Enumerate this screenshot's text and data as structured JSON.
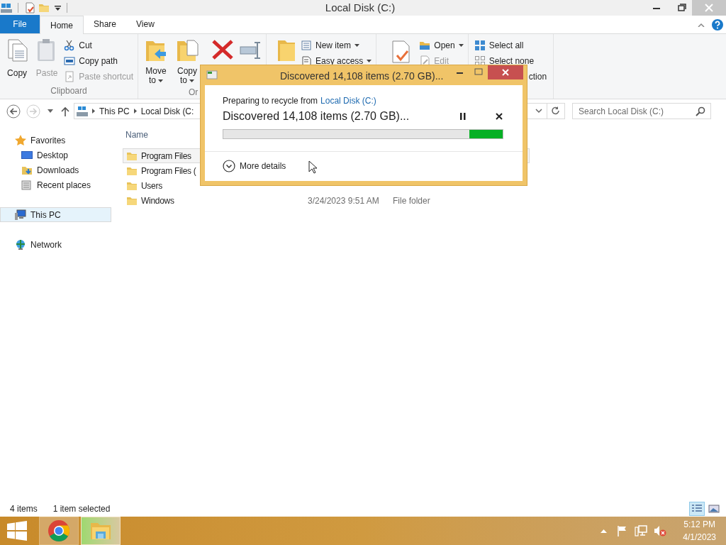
{
  "window": {
    "title": "Local Disk (C:)"
  },
  "ribbon_tabs": [
    {
      "label": "File",
      "kind": "file",
      "selected": false
    },
    {
      "label": "Home",
      "kind": "tab",
      "selected": true
    },
    {
      "label": "Share",
      "kind": "tab",
      "selected": false
    },
    {
      "label": "View",
      "kind": "tab",
      "selected": false
    }
  ],
  "ribbon": {
    "clipboard": {
      "large": [
        {
          "label": "Copy",
          "kind": "copy",
          "disabled": false
        },
        {
          "label": "Paste",
          "kind": "paste",
          "disabled": true
        }
      ],
      "small": [
        {
          "label": "Cut",
          "kind": "cut",
          "disabled": false
        },
        {
          "label": "Copy path",
          "kind": "path",
          "disabled": false
        },
        {
          "label": "Paste shortcut",
          "kind": "shortcut",
          "disabled": true
        }
      ],
      "group_label": "Clipboard"
    },
    "organize": {
      "buttons": [
        {
          "label": "Move",
          "label_2": "to",
          "kind": "move"
        },
        {
          "label": "Copy",
          "label_2": "to",
          "kind": "copyto"
        }
      ],
      "group_label": "Or"
    },
    "new": {
      "small": [
        {
          "label": "New item",
          "kind": "newitem"
        },
        {
          "label": "Easy access",
          "kind": "easy"
        }
      ]
    },
    "open": {
      "small": [
        {
          "label": "Open",
          "kind": "open",
          "disabled": false
        },
        {
          "label": "Edit",
          "kind": "edit",
          "disabled": true
        }
      ]
    },
    "select": {
      "small": [
        {
          "label": "Select all",
          "kind": "all"
        },
        {
          "label": "Select none",
          "kind": "none"
        },
        {
          "label": "ction",
          "kind": "cut-off"
        }
      ]
    }
  },
  "address": {
    "crumbs": [
      "This PC",
      "Local Disk (C:"
    ],
    "search_placeholder": "Search Local Disk (C:)"
  },
  "navigation": [
    {
      "label": "Favorites",
      "kind": "star",
      "selected": false,
      "children": [
        {
          "label": "Desktop",
          "kind": "desktop",
          "selected": false
        },
        {
          "label": "Downloads",
          "kind": "downloads",
          "selected": false
        },
        {
          "label": "Recent places",
          "kind": "recent",
          "selected": false
        }
      ]
    },
    {
      "label": "This PC",
      "kind": "pc",
      "selected": true
    },
    {
      "label": "Network",
      "kind": "network",
      "selected": false
    }
  ],
  "files": {
    "columns": [
      "Name"
    ],
    "rows": [
      {
        "name": "Program Files",
        "selected": true
      },
      {
        "name": "Program Files (",
        "selected": false
      },
      {
        "name": "Users",
        "selected": false
      },
      {
        "name": "Windows",
        "selected": false,
        "date": "3/24/2023 9:51 AM",
        "type": "File folder"
      }
    ]
  },
  "status_bar": {
    "count": "4 items",
    "selection": "1 item selected",
    "views": [
      {
        "kind": "details",
        "selected": true
      },
      {
        "kind": "large",
        "selected": false
      }
    ]
  },
  "dialog": {
    "title": "Discovered 14,108 items (2.70 GB)...",
    "prefix": "Preparing to recycle from",
    "link": "Local Disk (C:)",
    "status": "Discovered 14,108 items (2.70 GB)...",
    "more_details": "More details",
    "expanded": false,
    "level": 0.12
  },
  "taskbar": {
    "apps": [
      {
        "kind": "chrome",
        "selected": false
      },
      {
        "kind": "explorer",
        "selected": true
      }
    ],
    "time": "5:12 PM",
    "date": "4/1/2023"
  }
}
